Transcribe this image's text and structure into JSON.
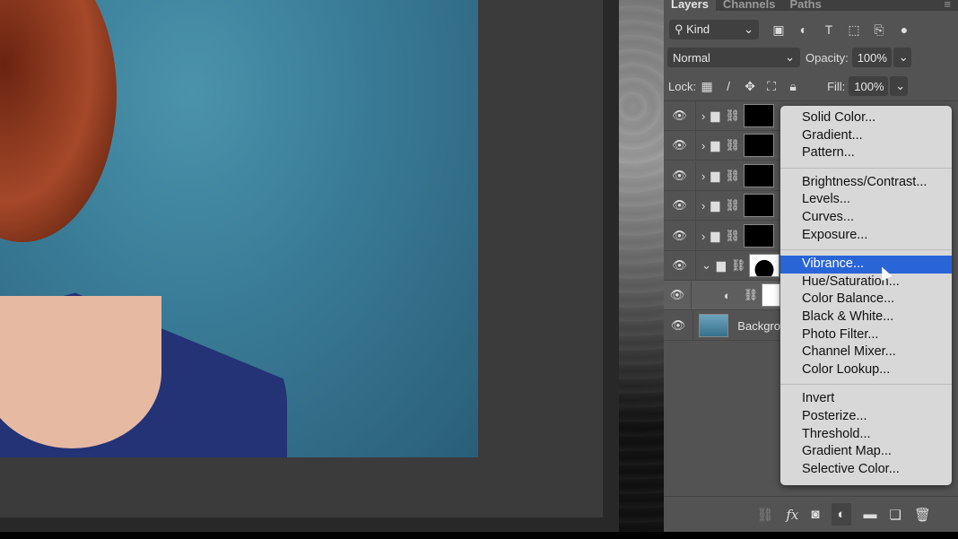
{
  "panel": {
    "tabs": [
      "Layers",
      "Channels",
      "Paths"
    ],
    "filter": "Kind",
    "blend_mode": "Normal",
    "opacity_label": "Opacity:",
    "opacity": "100%",
    "lock_label": "Lock:",
    "fill_label": "Fill:",
    "fill": "100%"
  },
  "layers": [
    {
      "type": "group",
      "expanded": false
    },
    {
      "type": "group",
      "expanded": false
    },
    {
      "type": "group",
      "expanded": false
    },
    {
      "type": "group",
      "expanded": false
    },
    {
      "type": "group",
      "expanded": false
    },
    {
      "type": "group",
      "expanded": true
    },
    {
      "type": "adjustment"
    },
    {
      "type": "pixel",
      "name": "Backgro"
    }
  ],
  "menu": {
    "groups": [
      [
        "Solid Color...",
        "Gradient...",
        "Pattern..."
      ],
      [
        "Brightness/Contrast...",
        "Levels...",
        "Curves...",
        "Exposure..."
      ],
      [
        "Vibrance...",
        "Hue/Saturation...",
        "Color Balance...",
        "Black & White...",
        "Photo Filter...",
        "Channel Mixer...",
        "Color Lookup..."
      ],
      [
        "Invert",
        "Posterize...",
        "Threshold...",
        "Gradient Map...",
        "Selective Color..."
      ]
    ],
    "highlighted": "Vibrance...",
    "highlight_color": "#2a65d8"
  },
  "bottom_icons": [
    "link-icon",
    "fx-icon",
    "mask-icon",
    "adjustment-icon",
    "folder-icon",
    "new-layer-icon",
    "trash-icon"
  ]
}
